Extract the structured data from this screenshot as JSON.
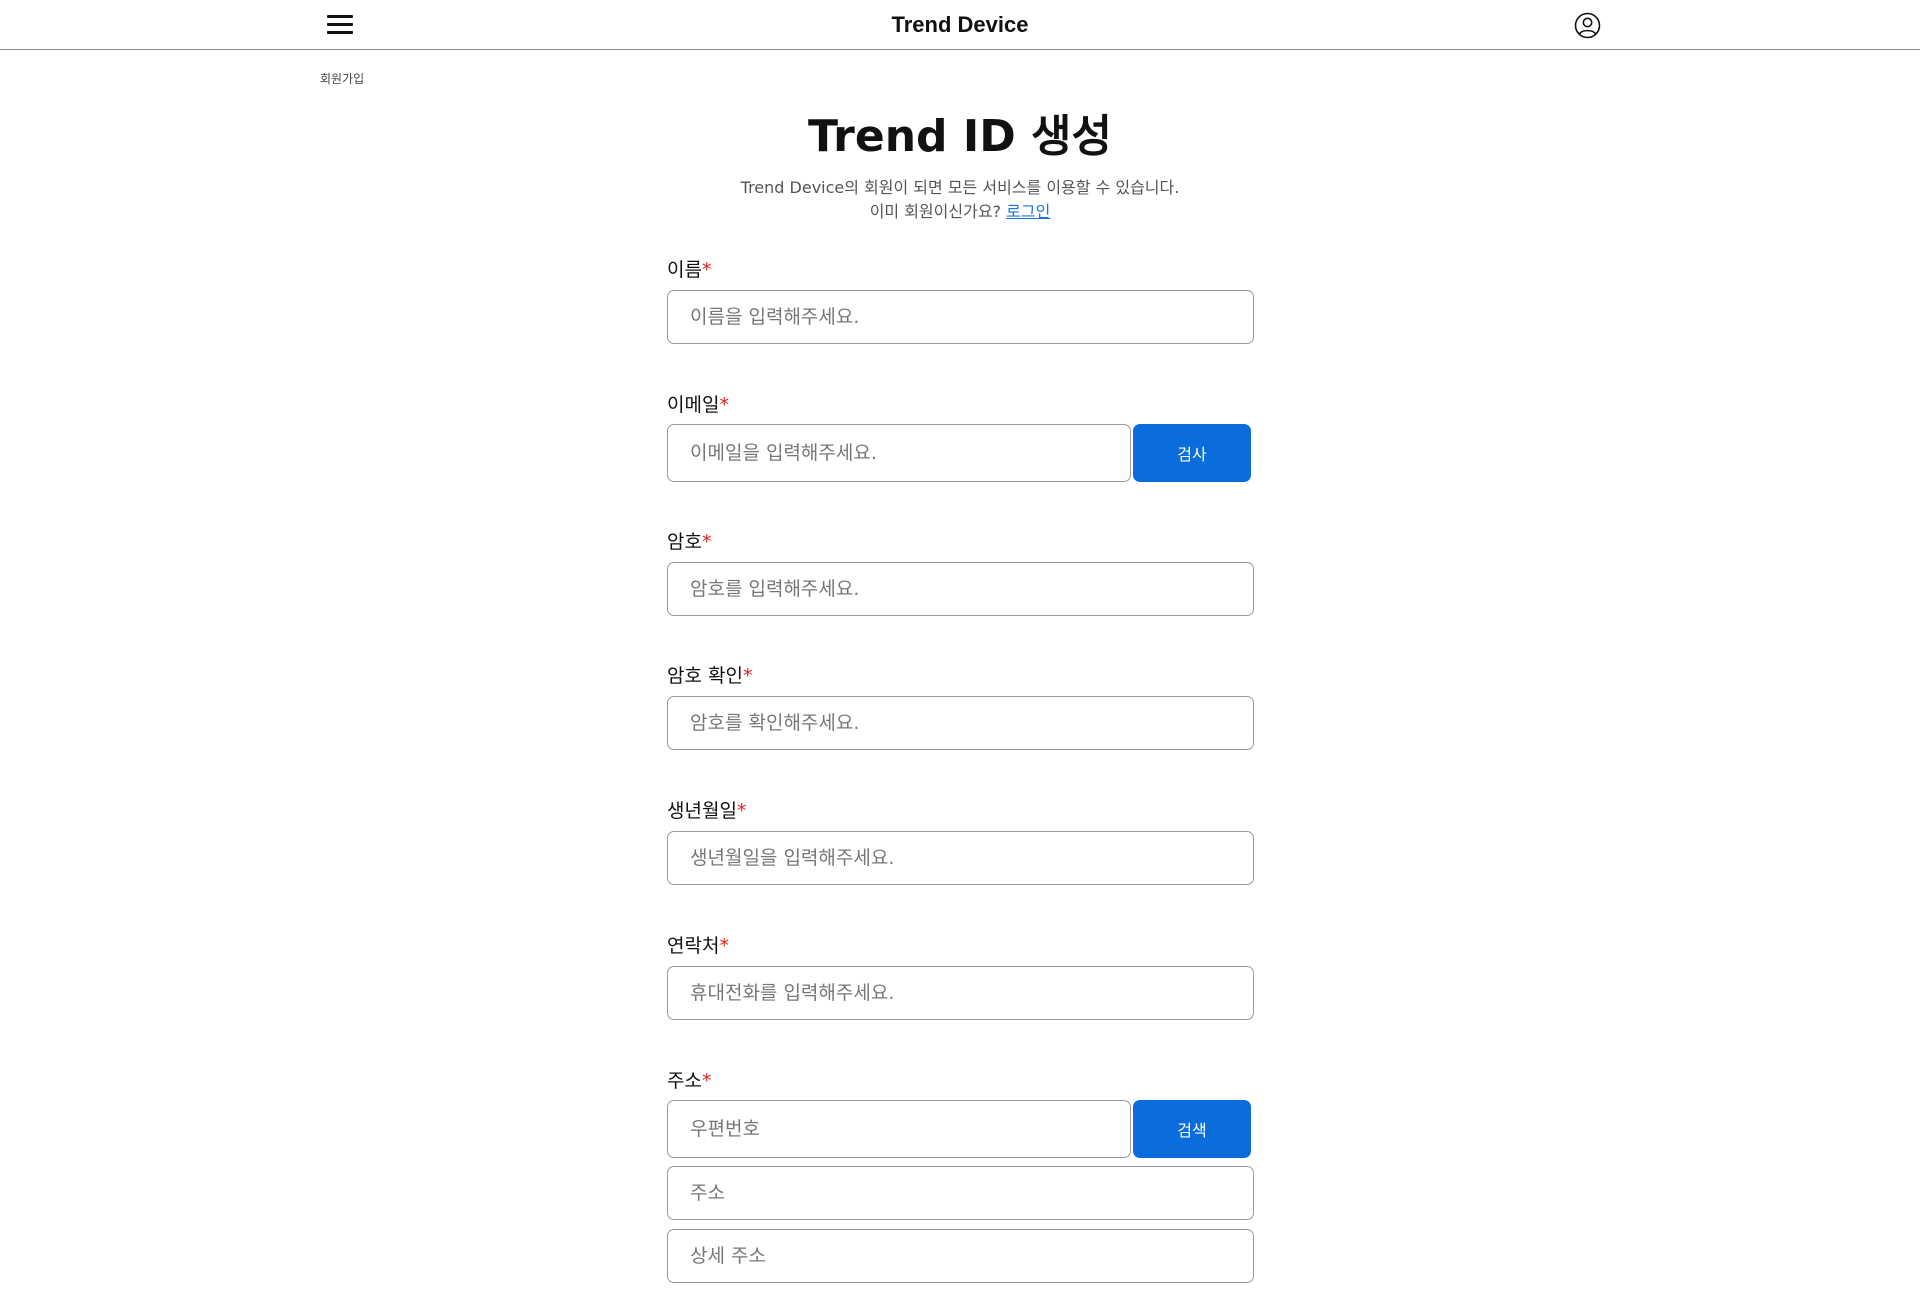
{
  "header": {
    "brand": "Trend Device",
    "menu_icon": "hamburger-menu-icon",
    "account_icon": "user-circle-icon"
  },
  "breadcrumb": "회원가입",
  "page": {
    "title": "Trend ID 생성",
    "subtitle": "Trend Device의 회원이 되면 모든 서비스를 이용할 수 있습니다.",
    "login_prompt": "이미 회원이신가요?",
    "login_link": "로그인"
  },
  "form": {
    "required_mark": "*",
    "name": {
      "label": "이름",
      "placeholder": "이름을 입력해주세요."
    },
    "email": {
      "label": "이메일",
      "placeholder": "이메일을 입력해주세요.",
      "button": "검사"
    },
    "password": {
      "label": "암호",
      "placeholder": "암호를 입력해주세요."
    },
    "password_confirm": {
      "label": "암호 확인",
      "placeholder": "암호를 확인해주세요."
    },
    "birthdate": {
      "label": "생년월일",
      "placeholder": "생년월일을 입력해주세요."
    },
    "phone": {
      "label": "연락처",
      "placeholder": "휴대전화를 입력해주세요."
    },
    "address": {
      "label": "주소",
      "postal_placeholder": "우편번호",
      "search_button": "검색",
      "address_placeholder": "주소",
      "detail_placeholder": "상세 주소"
    }
  },
  "colors": {
    "primary": "#0a6ddb",
    "required": "#e02020",
    "link": "#1a73e8"
  }
}
